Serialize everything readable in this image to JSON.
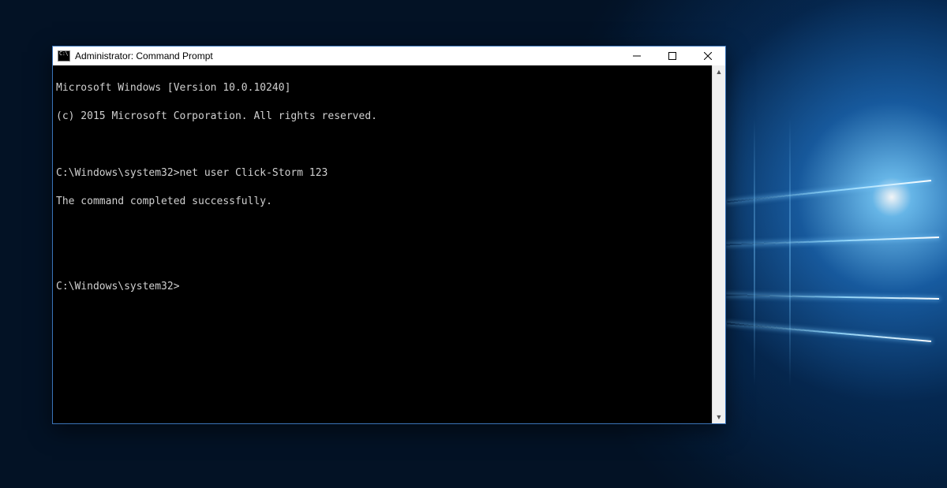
{
  "window": {
    "title": "Administrator: Command Prompt",
    "icon_name": "cmd-icon"
  },
  "controls": {
    "minimize": "Minimize",
    "maximize": "Maximize",
    "close": "Close"
  },
  "console": {
    "lines": [
      "Microsoft Windows [Version 10.0.10240]",
      "(c) 2015 Microsoft Corporation. All rights reserved.",
      "",
      "C:\\Windows\\system32>net user Click-Storm 123",
      "The command completed successfully.",
      "",
      "",
      "C:\\Windows\\system32>"
    ]
  },
  "scrollbar": {
    "up": "▲",
    "down": "▼"
  }
}
